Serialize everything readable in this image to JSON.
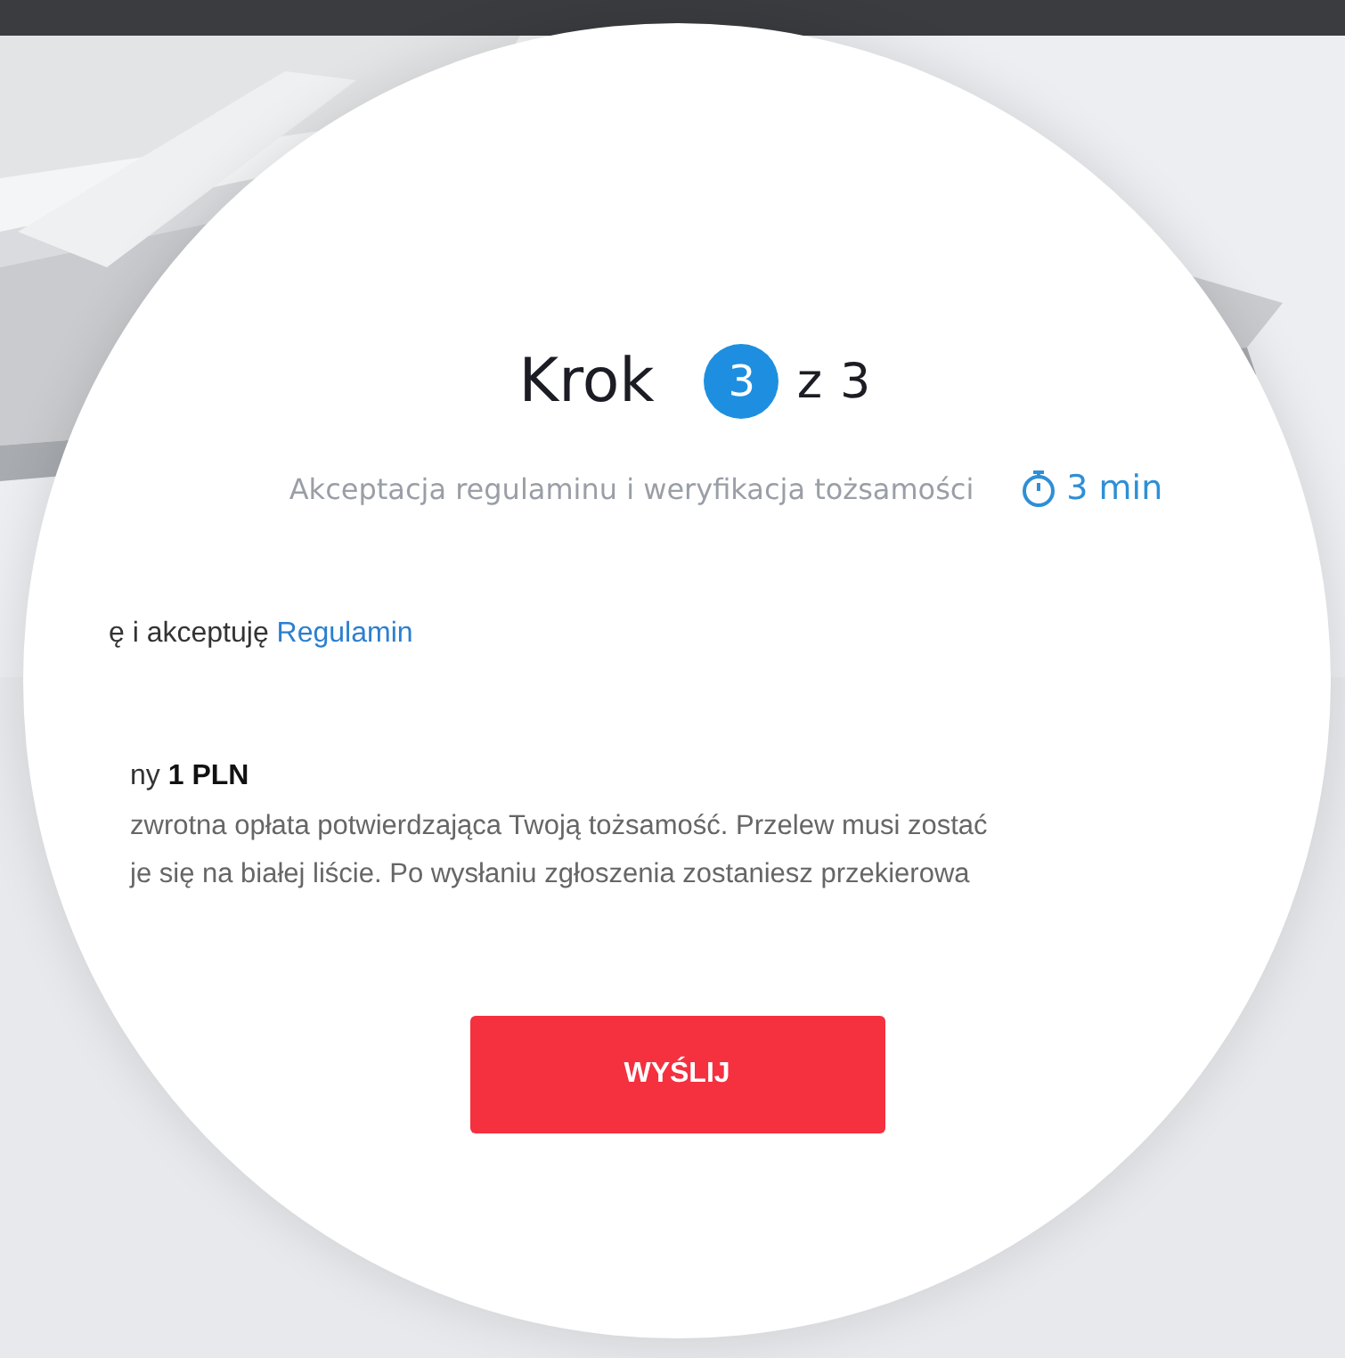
{
  "step": {
    "label": "Krok",
    "current": "3",
    "separator": "z",
    "total": "3"
  },
  "subtitle": "Akceptacja regulaminu i weryfikacja tożsamości",
  "duration": "3 min",
  "terms": {
    "text": "ę i akceptuję",
    "link": "Regulamin"
  },
  "fee": "ny **1 PLN**",
  "description": [
    "zwrotna opłata potwierdzająca Twoją tożsamość. Przelew musi zostać",
    "je się na białej liście. Po wysłaniu zgłoszenia zostaniesz przekierowa"
  ],
  "submit_button": "WYŚLIJ"
}
